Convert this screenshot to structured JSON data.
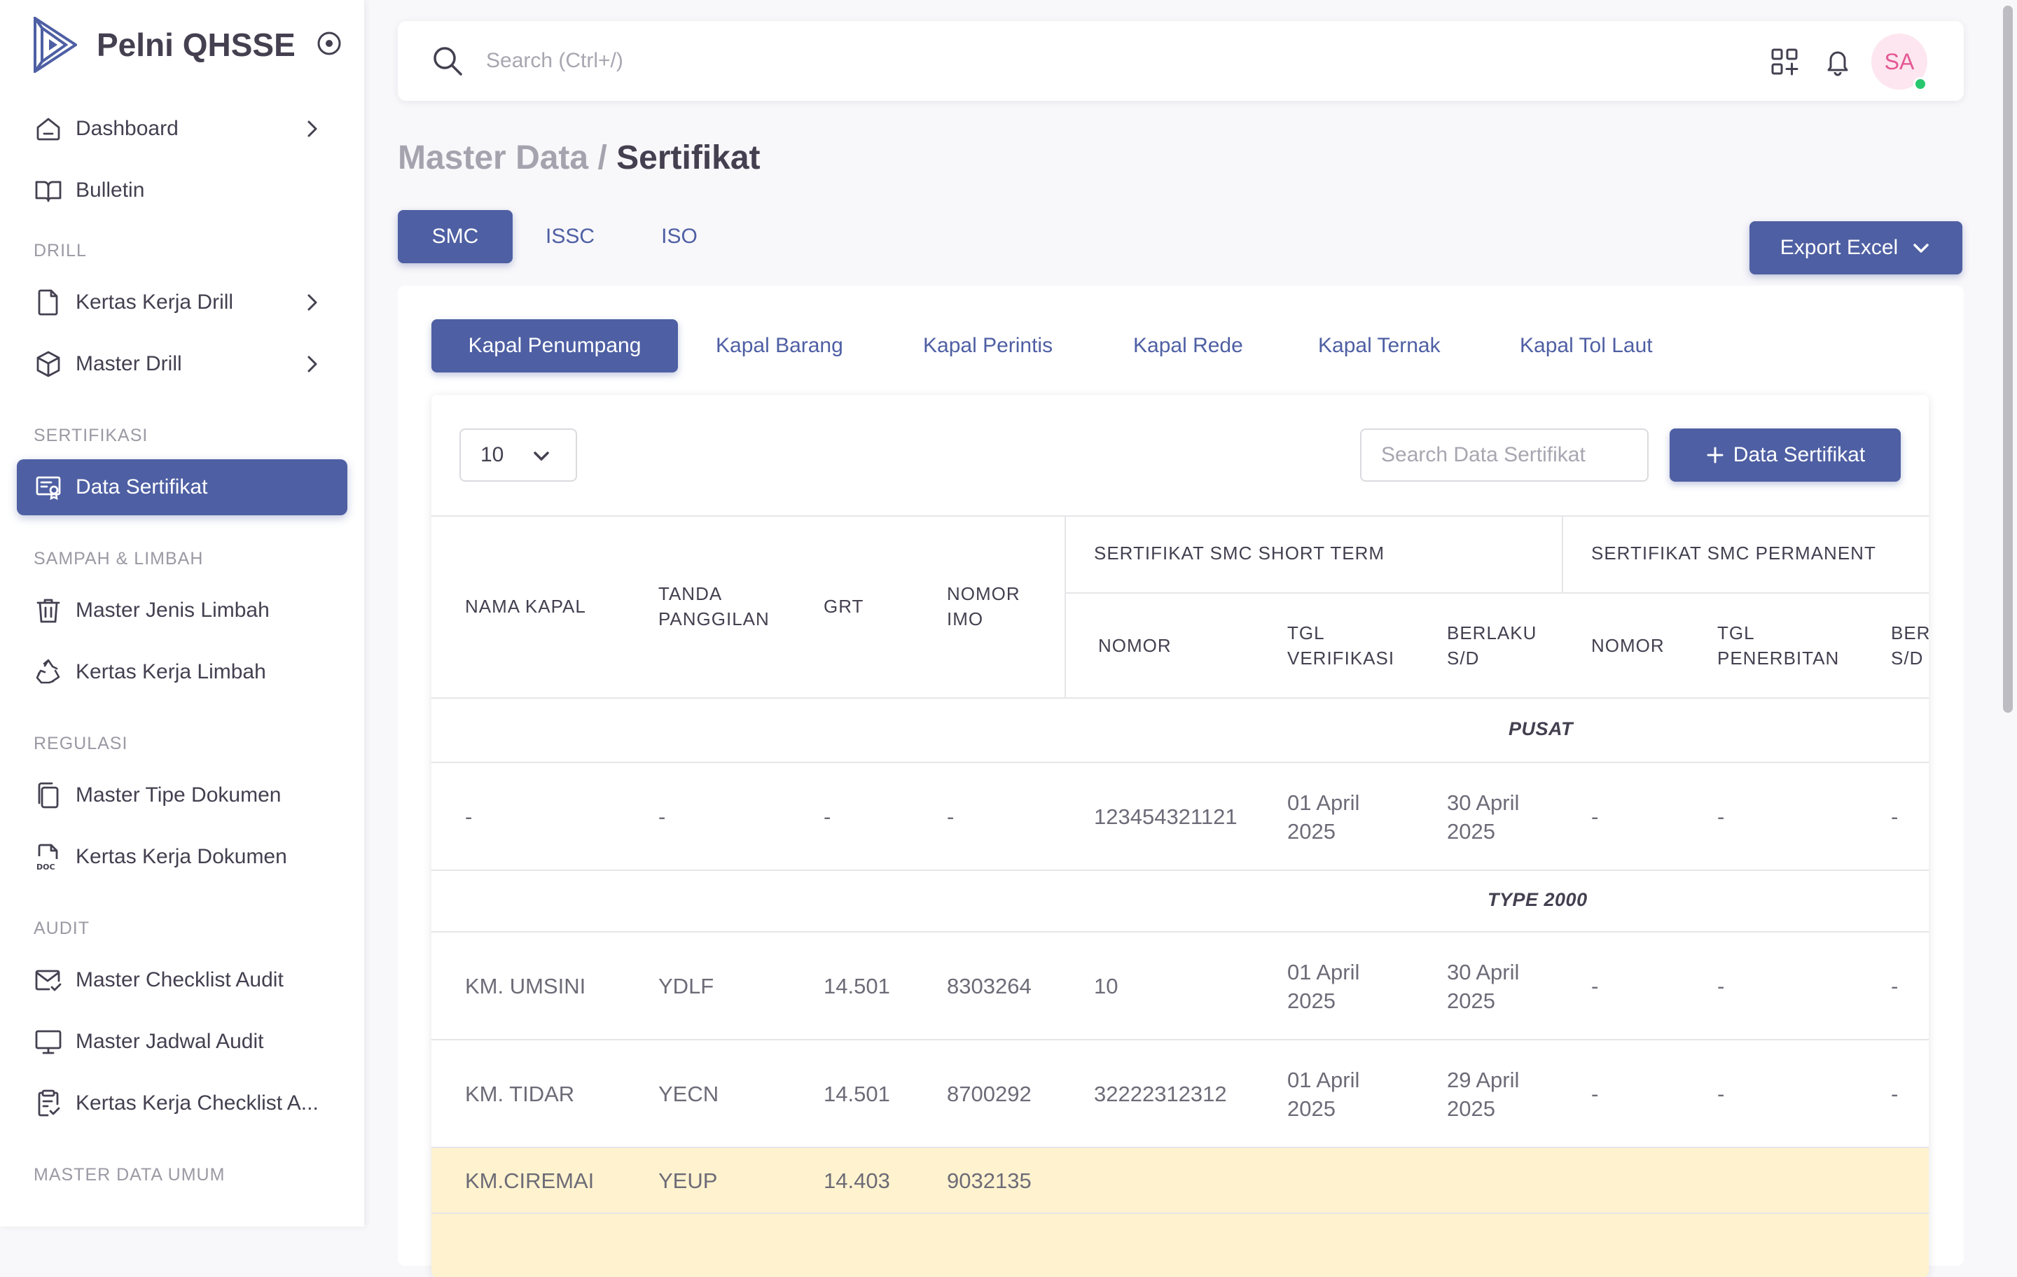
{
  "brand": {
    "name": "Pelni QHSSE"
  },
  "sidebar": {
    "items": [
      {
        "label": "Dashboard",
        "icon": "home-icon",
        "has_children": true
      },
      {
        "label": "Bulletin",
        "icon": "book-icon",
        "has_children": false
      }
    ],
    "sections": [
      {
        "title": "DRILL",
        "items": [
          {
            "label": "Kertas Kerja Drill",
            "icon": "file-icon",
            "has_children": true
          },
          {
            "label": "Master Drill",
            "icon": "box-icon",
            "has_children": true
          }
        ]
      },
      {
        "title": "SERTIFIKASI",
        "items": [
          {
            "label": "Data Sertifikat",
            "icon": "certificate-icon",
            "active": true
          }
        ]
      },
      {
        "title": "SAMPAH & LIMBAH",
        "items": [
          {
            "label": "Master Jenis Limbah",
            "icon": "trash-icon"
          },
          {
            "label": "Kertas Kerja Limbah",
            "icon": "recycle-icon"
          }
        ]
      },
      {
        "title": "REGULASI",
        "items": [
          {
            "label": "Master Tipe Dokumen",
            "icon": "copy-icon"
          },
          {
            "label": "Kertas Kerja Dokumen",
            "icon": "doc-file-icon"
          }
        ]
      },
      {
        "title": "AUDIT",
        "items": [
          {
            "label": "Master Checklist Audit",
            "icon": "mail-check-icon"
          },
          {
            "label": "Master Jadwal Audit",
            "icon": "monitor-icon"
          },
          {
            "label": "Kertas Kerja Checklist A...",
            "icon": "clipboard-check-icon"
          }
        ]
      },
      {
        "title": "MASTER DATA UMUM",
        "items": []
      }
    ]
  },
  "topbar": {
    "search_placeholder": "Search (Ctrl+/)",
    "avatar_initials": "SA"
  },
  "page": {
    "breadcrumb_parent": "Master Data /",
    "title": "Sertifikat"
  },
  "cert_tabs": [
    "SMC",
    "ISSC",
    "ISO"
  ],
  "export_label": "Export Excel",
  "ship_tabs": [
    "Kapal Penumpang",
    "Kapal Barang",
    "Kapal Perintis",
    "Kapal Rede",
    "Kapal Ternak",
    "Kapal Tol Laut"
  ],
  "table": {
    "page_size": "10",
    "search_placeholder": "Search Data Sertifikat",
    "add_label": "Data Sertifikat",
    "headers": {
      "nama_kapal": "NAMA KAPAL",
      "tanda_panggilan": "TANDA PANGGILAN",
      "grt": "GRT",
      "nomor_imo": "NOMOR IMO",
      "short_term_group": "SERTIFIKAT SMC SHORT TERM",
      "permanent_group": "SERTIFIKAT SMC PERMANENT",
      "st_nomor": "NOMOR",
      "st_tgl": "TGL VERIFIKASI",
      "st_berlaku": "BERLAKU S/D",
      "p_nomor": "NOMOR",
      "p_tgl": "TGL PENERBITAN",
      "p_berlaku": "BERLAKU S/D"
    },
    "groups": [
      {
        "label": "PUSAT",
        "rows": [
          {
            "nama": "-",
            "tanda": "-",
            "grt": "-",
            "imo": "-",
            "st_nomor": "123454321121",
            "st_tgl": "01 April 2025",
            "st_berlaku": "30 April 2025",
            "p_nomor": "-",
            "p_tgl": "-",
            "p_berlaku": "-"
          }
        ]
      },
      {
        "label": "TYPE 2000",
        "rows": [
          {
            "nama": "KM. UMSINI",
            "tanda": "YDLF",
            "grt": "14.501",
            "imo": "8303264",
            "st_nomor": "10",
            "st_tgl": "01 April 2025",
            "st_berlaku": "30 April 2025",
            "p_nomor": "-",
            "p_tgl": "-",
            "p_berlaku": "-"
          },
          {
            "nama": "KM. TIDAR",
            "tanda": "YECN",
            "grt": "14.501",
            "imo": "8700292",
            "st_nomor": "32222312312",
            "st_tgl": "01 April 2025",
            "st_berlaku": "29 April 2025",
            "p_nomor": "-",
            "p_tgl": "-",
            "p_berlaku": "-"
          },
          {
            "nama": "KM.CIREMAI",
            "tanda": "YEUP",
            "grt": "14.403",
            "imo": "9032135",
            "st_nomor": "",
            "st_tgl": "",
            "st_berlaku": "",
            "p_nomor": "",
            "p_tgl": "",
            "p_berlaku": ""
          }
        ]
      }
    ]
  },
  "colors": {
    "primary": "#4e5fa3",
    "highlight_row": "#fff3cf",
    "avatar_bg": "#fde6ef",
    "avatar_text": "#e45894",
    "online": "#28c76f"
  }
}
